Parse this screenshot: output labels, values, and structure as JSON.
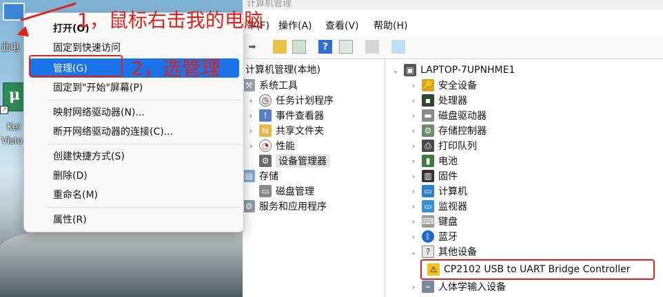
{
  "desktop": {
    "icon_this_pc_label": "此电",
    "icon_keil_label_line1": "Kei",
    "icon_keil_label_line2": "Visio",
    "icon_keil_glyph": "μ"
  },
  "window": {
    "title": "计算机管理",
    "menu": [
      "文件(F)",
      "操作(A)",
      "查看(V)",
      "帮助(H)"
    ],
    "menu_visible": [
      "牛(F)",
      "操作(A)",
      "查看(V)",
      "帮助(H)"
    ]
  },
  "context_menu": {
    "items": [
      {
        "label": "打开(O)",
        "bold": true
      },
      {
        "label": "固定到快速访问"
      },
      {
        "label": "管理(G)",
        "selected": true
      },
      {
        "label": "固定到\"开始\"屏幕(P)"
      },
      {
        "label": "映射网络驱动器(N)..."
      },
      {
        "label": "断开网络驱动器的连接(C)..."
      },
      {
        "label": "创建快捷方式(S)"
      },
      {
        "label": "删除(D)"
      },
      {
        "label": "重命名(M)"
      },
      {
        "label": "属性(R)"
      }
    ]
  },
  "annotations": {
    "step1": "1，鼠标右击我的电脑",
    "step2": "2，选管理"
  },
  "left_tree": {
    "root": "计算机管理(本地)",
    "system_tools": "系统工具",
    "task_scheduler": "任务计划程序",
    "event_viewer": "事件查看器",
    "shared_folders": "共享文件夹",
    "performance": "性能",
    "device_manager": "设备管理器",
    "storage": "存储",
    "disk_management": "磁盘管理",
    "services_apps": "服务和应用程序"
  },
  "right_tree": {
    "computer_name": "LAPTOP-7UPNHME1",
    "categories": [
      "安全设备",
      "处理器",
      "磁盘驱动器",
      "存储控制器",
      "打印队列",
      "电池",
      "固件",
      "计算机",
      "监视器",
      "键盘",
      "蓝牙"
    ],
    "other_devices": "其他设备",
    "cp2102": "CP2102 USB to UART Bridge Controller",
    "hid": "人体学输入设备"
  },
  "colors": {
    "accent_red": "#e0201b",
    "menu_selected": "#1a73e8"
  }
}
